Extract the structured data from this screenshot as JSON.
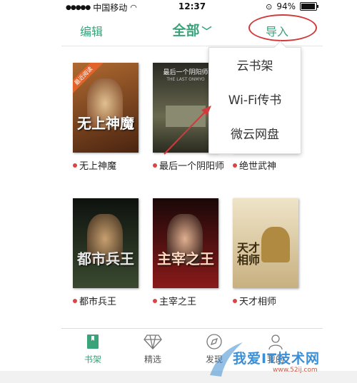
{
  "status_bar": {
    "carrier": "中国移动",
    "time": "12:37",
    "battery": "94%",
    "battery_fraction": 0.94
  },
  "nav": {
    "edit_label": "编辑",
    "title": "全部",
    "import_label": "导入"
  },
  "dropdown": {
    "items": [
      {
        "label": "云书架"
      },
      {
        "label": "Wi-Fi传书"
      },
      {
        "label": "微云网盘"
      }
    ]
  },
  "books": [
    {
      "name": "无上神魔",
      "cover_title": "无上神魔",
      "ribbon": "最近阅读",
      "cover_color": "#6a3a20"
    },
    {
      "name": "最后一个阴阳师",
      "cover_title": "最后一个阴阳师",
      "cover_subtitle": "THE LAST ONMYO",
      "cover_color": "#3a3a30"
    },
    {
      "name": "绝世武神",
      "cover_title": "",
      "cover_color": "#8a7a60"
    },
    {
      "name": "都市兵王",
      "cover_title": "都市兵王",
      "cover_color": "#1f2a20"
    },
    {
      "name": "主宰之王",
      "cover_title": "主宰之王",
      "cover_color": "#5a1010"
    },
    {
      "name": "天才相师",
      "cover_title": "天才相师",
      "cover_color": "#d8c8a0"
    }
  ],
  "tabbar": {
    "tabs": [
      {
        "label": "书架",
        "icon": "bookshelf-icon",
        "active": true
      },
      {
        "label": "精选",
        "icon": "diamond-icon",
        "active": false
      },
      {
        "label": "发现",
        "icon": "compass-icon",
        "active": false
      },
      {
        "label": "我的",
        "icon": "user-icon",
        "active": false
      }
    ]
  },
  "watermark": {
    "line1": "我爱IT技术网",
    "line2": "www.52ij.com"
  },
  "colors": {
    "accent": "#3aa37a",
    "annotation": "#d03a3a",
    "book_dot": "#d94545"
  }
}
